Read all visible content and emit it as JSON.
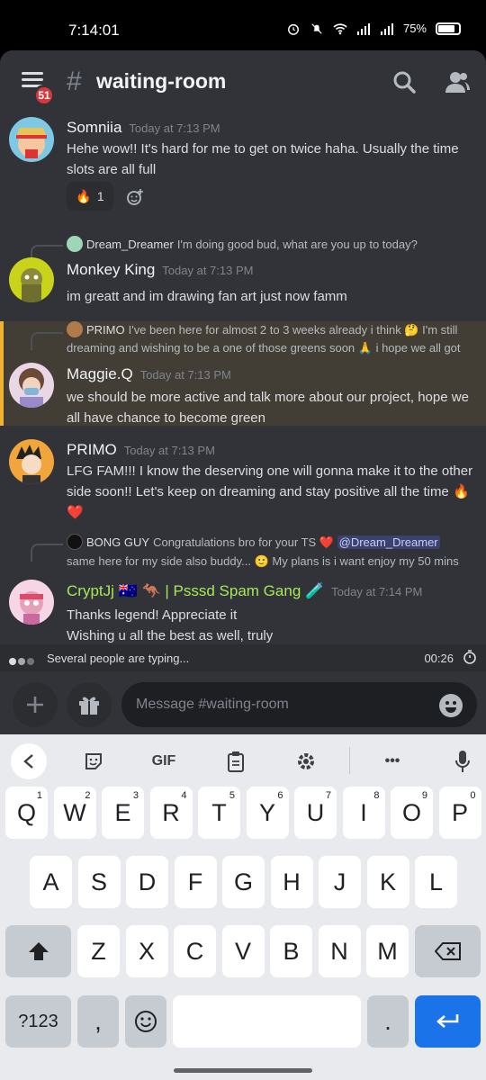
{
  "status_bar": {
    "time": "7:14:01",
    "battery": "75%"
  },
  "header": {
    "channel": "waiting-room",
    "hash": "#",
    "badge_count": "51"
  },
  "messages": [
    {
      "author": "Somniia",
      "timestamp": "Today at 7:13 PM",
      "text": "Hehe wow!! It's hard for me to get on twice haha. Usually the time slots are all full",
      "reaction": {
        "emoji": "🔥",
        "count": "1"
      }
    },
    {
      "reply_author": "Dream_Dreamer",
      "reply_text": "I'm doing good bud, what are you up to today?",
      "author": "Monkey King",
      "timestamp": "Today at 7:13 PM",
      "text": "im greatt and im drawing fan art just now famm"
    },
    {
      "reply_author": "PRIMO",
      "reply_text_line1": "I've been here for almost 2 to 3 weeks already i think 🤔 I'm still",
      "reply_text_line2": "dreaming and wishing to be a one of those greens soon 🙏 i hope we all got",
      "author": "Maggie.Q",
      "timestamp": "Today at 7:13 PM",
      "text": "we should be more active and talk more about our project,  hope we all have chance to become green"
    },
    {
      "author": "PRIMO",
      "timestamp": "Today at 7:13 PM",
      "text": "LFG FAM!!!  I know the deserving one will gonna make it to the other side soon!! Let's keep on dreaming and stay positive all the time 🔥❤️"
    },
    {
      "reply_author": "BONG GUY",
      "reply_text_line1": "Congratulations bro for your TS ❤️",
      "reply_mention": "@Dream_Dreamer",
      "reply_text_line2": "same here for my side also buddy... 🙂 My plans is i want enjoy my 50 mins",
      "author": "CryptJj 🇦🇺 🦘 |  Psssd Spam Gang 🧪",
      "timestamp": "Today at 7:14 PM",
      "text_line1": "Thanks legend! Appreciate it",
      "text_line2": "Wishing u all the best as well, truly"
    }
  ],
  "typing": {
    "text": "Several people are typing...",
    "timer": "00:26"
  },
  "composer": {
    "placeholder": "Message #waiting-room"
  },
  "keyboard": {
    "toolbar": {
      "gif": "GIF",
      "more": "•••"
    },
    "row1": [
      {
        "k": "Q",
        "n": "1"
      },
      {
        "k": "W",
        "n": "2"
      },
      {
        "k": "E",
        "n": "3"
      },
      {
        "k": "R",
        "n": "4"
      },
      {
        "k": "T",
        "n": "5"
      },
      {
        "k": "Y",
        "n": "6"
      },
      {
        "k": "U",
        "n": "7"
      },
      {
        "k": "I",
        "n": "8"
      },
      {
        "k": "O",
        "n": "9"
      },
      {
        "k": "P",
        "n": "0"
      }
    ],
    "row2": [
      "A",
      "S",
      "D",
      "F",
      "G",
      "H",
      "J",
      "K",
      "L"
    ],
    "row3": [
      "Z",
      "X",
      "C",
      "V",
      "B",
      "N",
      "M"
    ],
    "symbols_key": "?123",
    "comma_key": ",",
    "period_key": "."
  },
  "colors": {
    "background": "#313338",
    "highlight": "#433e35",
    "highlight_border": "#f0b232",
    "cryptjj_name": "#a6e85a",
    "accent_blue": "#1a73e8"
  }
}
